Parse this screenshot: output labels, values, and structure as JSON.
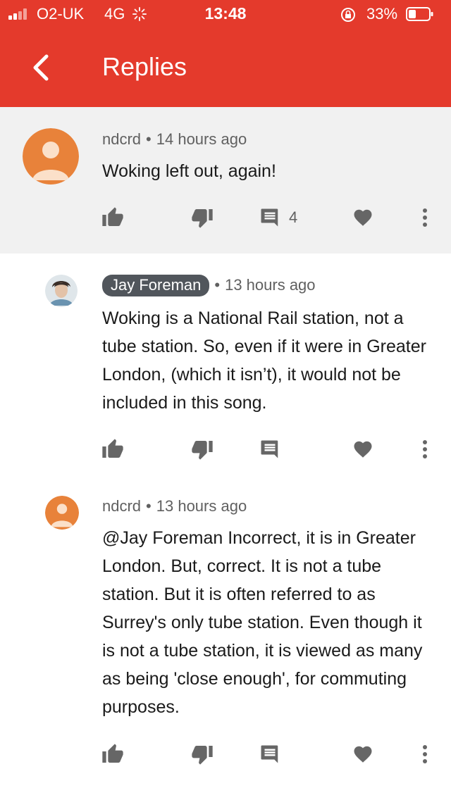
{
  "status_bar": {
    "carrier": "O2-UK",
    "network": "4G",
    "time": "13:48",
    "battery": "33%",
    "icons": [
      "signal-icon",
      "spinner-icon",
      "rotation-lock-icon",
      "battery-icon"
    ]
  },
  "app_bar": {
    "title": "Replies",
    "back_icon": "chevron-left-icon"
  },
  "colors": {
    "header": "#e43a2c",
    "parent_bg": "#f1f1f1",
    "avatar_orange": "#e8823a",
    "icon_gray": "#666666"
  },
  "comments": [
    {
      "author": "ndcrd",
      "time": "14 hours ago",
      "text": "Woking left out, again!",
      "reply_count": "4",
      "avatar": "default-avatar-icon"
    },
    {
      "author": "Jay Foreman",
      "time": "13 hours ago",
      "text": "Woking is a National Rail station, not a tube station. So, even if it were in Greater London, (which it isn’t), it would not be included in this song.",
      "avatar": "photo-avatar",
      "is_creator": true
    },
    {
      "author": "ndcrd",
      "time": "13 hours ago",
      "text": "@Jay Foreman Incorrect, it is in Greater London. But, correct. It is not a tube station. But it is often referred to as Surrey's only tube station. Even though it is not a tube station, it is viewed as many as being 'close enough', for commuting purposes.",
      "avatar": "default-avatar-icon"
    }
  ],
  "separator": "•"
}
